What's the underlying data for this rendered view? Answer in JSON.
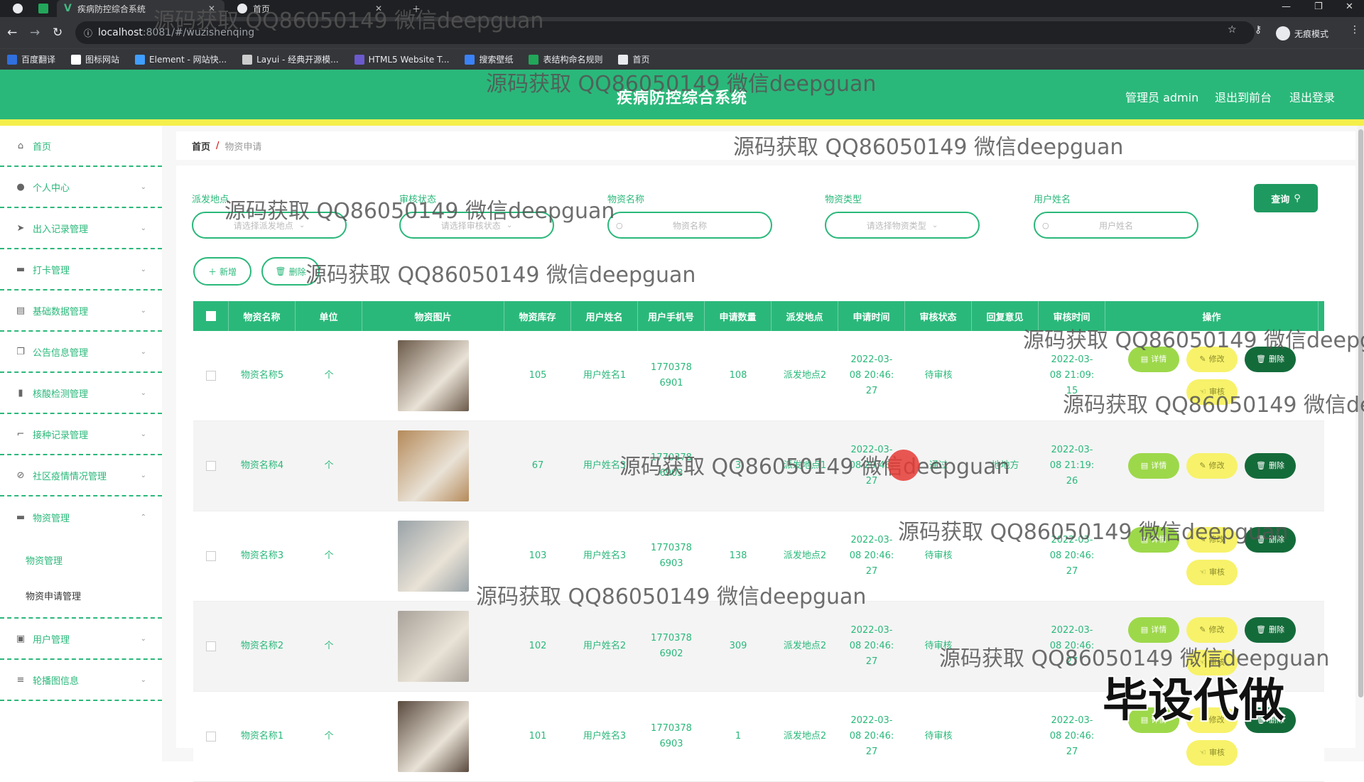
{
  "browser": {
    "tabs": [
      {
        "label": "疾病防控综合系统",
        "active": true
      },
      {
        "label": "首页",
        "active": false
      }
    ],
    "url_host": "localhost",
    "url_path": ":8081/#/wuzishenqing",
    "incognito_label": "无痕模式",
    "bookmarks": [
      {
        "label": "百度翻译",
        "icon": "baidu-translate-icon",
        "color": "#2f6fde"
      },
      {
        "label": "图标网站",
        "icon": "flag-icon",
        "color": "#ffffff"
      },
      {
        "label": "Element - 网站快...",
        "icon": "element-icon",
        "color": "#409eff"
      },
      {
        "label": "Layui - 经典开源模...",
        "icon": "layui-icon",
        "color": "#cccccc"
      },
      {
        "label": "HTML5 Website T...",
        "icon": "html5-icon",
        "color": "#6a5acd"
      },
      {
        "label": "搜索壁纸",
        "icon": "wallpaper-icon",
        "color": "#3b82f6"
      },
      {
        "label": "表结构命名规则",
        "icon": "sheet-icon",
        "color": "#22a65a"
      },
      {
        "label": "首页",
        "icon": "globe-icon",
        "color": "#e8eaed"
      }
    ]
  },
  "header": {
    "title": "疾病防控综合系统",
    "admin_label": "管理员 admin",
    "front_label": "退出到前台",
    "logout_label": "退出登录"
  },
  "sidebar": {
    "items": [
      {
        "label": "首页",
        "icon": "home-icon",
        "glyph": "⌂"
      },
      {
        "label": "个人中心",
        "icon": "user-icon",
        "glyph": "●"
      },
      {
        "label": "出入记录管理",
        "icon": "send-icon",
        "glyph": "➤"
      },
      {
        "label": "打卡管理",
        "icon": "printer-icon",
        "glyph": "▬"
      },
      {
        "label": "基础数据管理",
        "icon": "clipboard-icon",
        "glyph": "▤"
      },
      {
        "label": "公告信息管理",
        "icon": "copy-icon",
        "glyph": "❐"
      },
      {
        "label": "核酸检测管理",
        "icon": "bar-chart-icon",
        "glyph": "▮"
      },
      {
        "label": "接种记录管理",
        "icon": "crop-icon",
        "glyph": "⌐"
      },
      {
        "label": "社区疫情情况管理",
        "icon": "ban-icon",
        "glyph": "⊘"
      },
      {
        "label": "物资管理",
        "icon": "box-icon",
        "glyph": "▬"
      },
      {
        "label": "用户管理",
        "icon": "id-card-icon",
        "glyph": "▣"
      },
      {
        "label": "轮播图信息",
        "icon": "sliders-icon",
        "glyph": "≡"
      }
    ],
    "subitems": [
      {
        "label": "物资管理"
      },
      {
        "label": "物资申请管理"
      }
    ]
  },
  "breadcrumb": {
    "home": "首页",
    "separator": "/",
    "current": "物资申请"
  },
  "filters": {
    "fields": [
      {
        "label": "派发地点",
        "placeholder": "请选择派发地点"
      },
      {
        "label": "审核状态",
        "placeholder": "请选择审核状态"
      },
      {
        "label": "物资名称",
        "placeholder": "物资名称"
      },
      {
        "label": "物资类型",
        "placeholder": "请选择物资类型"
      },
      {
        "label": "用户姓名",
        "placeholder": "用户姓名"
      }
    ],
    "query_label": "查询"
  },
  "actions": {
    "add_label": "新增",
    "delete_label": "删除"
  },
  "table": {
    "columns": [
      "物资名称",
      "单位",
      "物资图片",
      "物资库存",
      "用户姓名",
      "用户手机号",
      "申请数量",
      "派发地点",
      "申请时间",
      "审核状态",
      "回复意见",
      "审核时间",
      "操作"
    ],
    "op_labels": {
      "detail": "详情",
      "edit": "修改",
      "delete": "删除",
      "audit": "审核"
    },
    "rows": [
      {
        "name": "物资名称5",
        "unit": "个",
        "stock": "105",
        "user": "用户姓名1",
        "phone": "17703786901",
        "qty": "108",
        "place": "派发地点2",
        "apply_time": "2022-03-08 20:46:27",
        "status": "待审核",
        "reply": "",
        "audit_time": "2022-03-08 21:09:15",
        "img": "#6b5a4a",
        "audit": true
      },
      {
        "name": "物资名称4",
        "unit": "个",
        "stock": "67",
        "user": "用户姓名3",
        "phone": "17703786903",
        "qty": "3",
        "place": "派发地点1",
        "apply_time": "2022-03-08 20:46:27",
        "status": "通过",
        "reply": "地地方",
        "audit_time": "2022-03-08 21:19:26",
        "img": "#b58a5a",
        "audit": false
      },
      {
        "name": "物资名称3",
        "unit": "个",
        "stock": "103",
        "user": "用户姓名3",
        "phone": "17703786903",
        "qty": "138",
        "place": "派发地点2",
        "apply_time": "2022-03-08 20:46:27",
        "status": "待审核",
        "reply": "",
        "audit_time": "2022-03-08 20:46:27",
        "img": "#9aa3a8",
        "audit": true
      },
      {
        "name": "物资名称2",
        "unit": "个",
        "stock": "102",
        "user": "用户姓名2",
        "phone": "17703786902",
        "qty": "309",
        "place": "派发地点2",
        "apply_time": "2022-03-08 20:46:27",
        "status": "待审核",
        "reply": "",
        "audit_time": "2022-03-08 20:46:27",
        "img": "#a8a29a",
        "audit": true
      },
      {
        "name": "物资名称1",
        "unit": "个",
        "stock": "101",
        "user": "用户姓名3",
        "phone": "17703786903",
        "qty": "1",
        "place": "派发地点2",
        "apply_time": "2022-03-08 20:46:27",
        "status": "待审核",
        "reply": "",
        "audit_time": "2022-03-08 20:46:27",
        "img": "#5a4a3e",
        "audit": true
      }
    ]
  },
  "watermark": {
    "text": "源码获取 QQ86050149 微信deepguan",
    "big_text": "毕设代做"
  }
}
